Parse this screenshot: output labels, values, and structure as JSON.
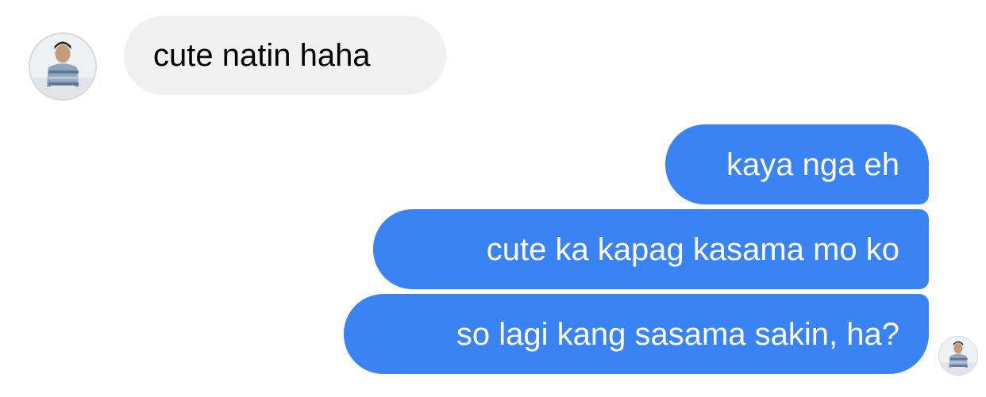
{
  "conversation": {
    "incoming_avatar_icon": "user-photo-avatar",
    "outgoing_avatar_icon": "user-photo-avatar",
    "messages": [
      {
        "sender": "other",
        "text": "cute natin haha"
      },
      {
        "sender": "me",
        "text": "kaya nga eh"
      },
      {
        "sender": "me",
        "text": "cute ka kapag kasama mo ko"
      },
      {
        "sender": "me",
        "text": "so lagi kang sasama sakin, ha?"
      }
    ]
  },
  "colors": {
    "incoming_bubble": "#f1f1f1",
    "outgoing_bubble": "#3a83f5",
    "incoming_text": "#000000",
    "outgoing_text": "#ffffff",
    "background": "#ffffff"
  }
}
